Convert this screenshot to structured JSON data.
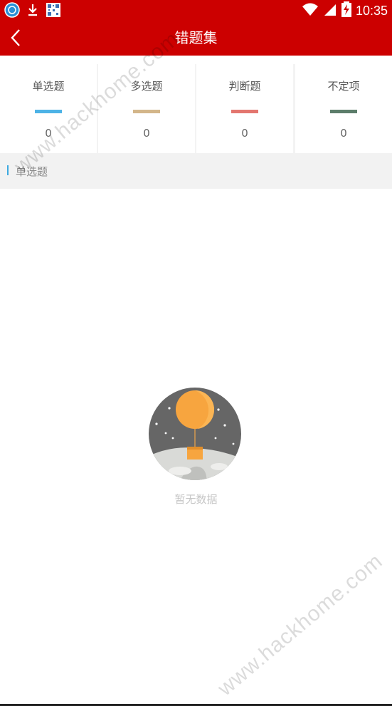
{
  "status_bar": {
    "time": "10:35",
    "icons": [
      "app-notification-icon",
      "download-icon",
      "qr-code-icon",
      "wifi-icon",
      "signal-icon",
      "battery-charging-icon"
    ]
  },
  "header": {
    "back_icon": "chevron-left-icon",
    "title": "错题集"
  },
  "categories": [
    {
      "label": "单选题",
      "count": "0",
      "color": "#4db3e6"
    },
    {
      "label": "多选题",
      "count": "0",
      "color": "#d3b68a"
    },
    {
      "label": "判断题",
      "count": "0",
      "color": "#e3766f"
    },
    {
      "label": "不定项",
      "count": "0",
      "color": "#5c7d6a"
    }
  ],
  "section": {
    "label": "单选题",
    "accent": "#3ca9e0"
  },
  "empty_state": {
    "text": "暂无数据",
    "icon": "balloon-moon-illustration"
  },
  "watermark": "www.hackhome.com",
  "colors": {
    "brand": "#cc0000"
  }
}
